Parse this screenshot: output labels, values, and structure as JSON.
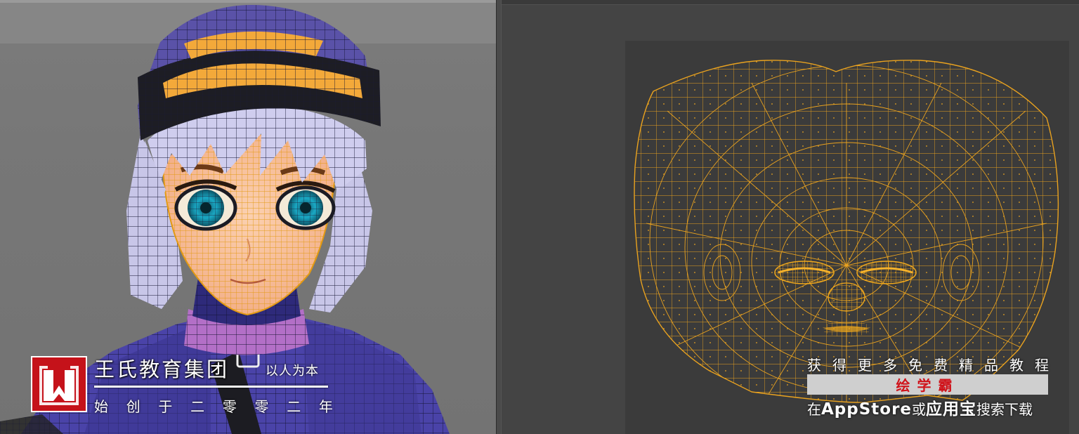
{
  "left_watermark": {
    "company": "王氏教育集团",
    "slogan": "以人为本",
    "since": [
      "始",
      "创",
      "于",
      "二",
      "零",
      "零",
      "二",
      "年"
    ]
  },
  "right_watermark": {
    "tagline": [
      "获",
      "得",
      "更",
      "多",
      "免",
      "费",
      "精",
      "品",
      "教",
      "程"
    ],
    "app_name": "绘学霸",
    "download_prefix": "在",
    "store_1": "AppStore",
    "or": "或",
    "store_2": "应用宝",
    "download_suffix": "搜索下载"
  },
  "colors": {
    "viewport_bg": "#7a7a7a",
    "uv_editor_bg": "#444444",
    "uv_wire": "#e9a21f",
    "hat": "#5a52a8",
    "hat_visor": "#f3a93a",
    "hair": "#c8c6e8",
    "skin": "#f5b894",
    "iris": "#1aa8c4",
    "jacket": "#4a43a8",
    "collar": "#b36fc7",
    "brand_red": "#c5121a"
  }
}
